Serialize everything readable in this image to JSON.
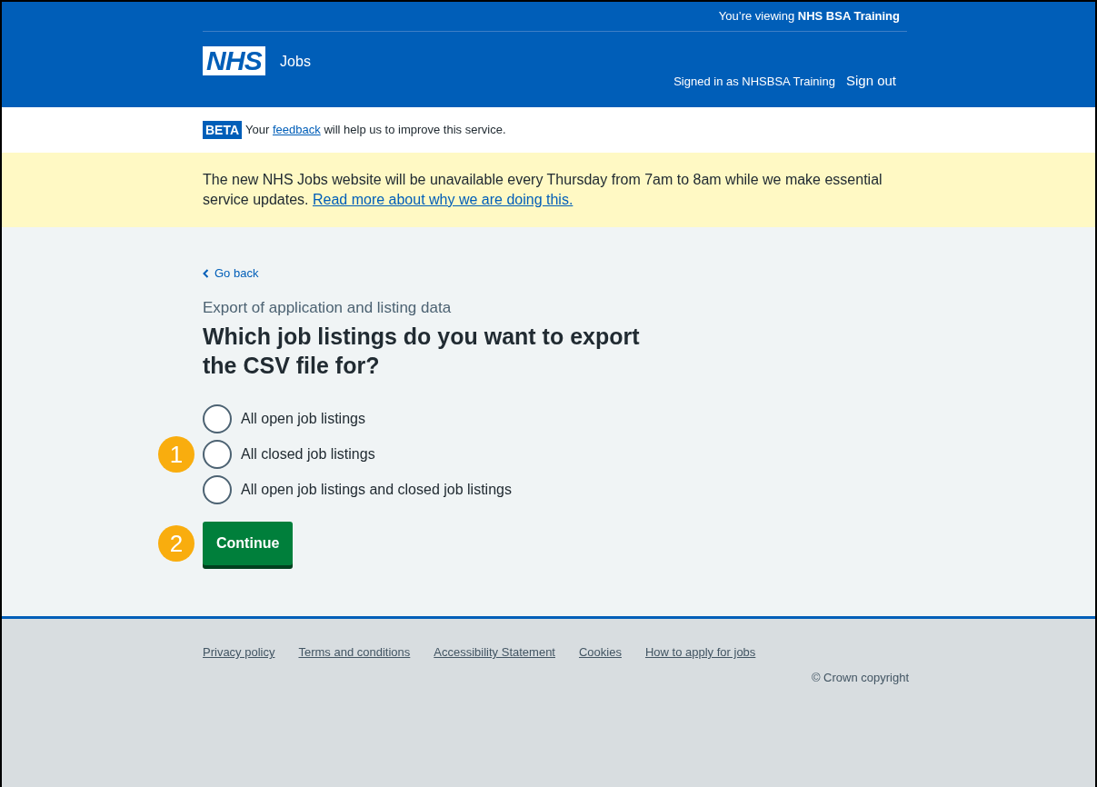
{
  "header": {
    "viewing_prefix": "You’re viewing",
    "viewing_org": "NHS BSA Training",
    "logo": "NHS",
    "service": "Jobs",
    "signed_in": "Signed in as NHSBSA Training",
    "sign_out": "Sign out"
  },
  "phase_banner": {
    "tag": "BETA",
    "before": "Your",
    "link": "feedback",
    "after": "will help us to improve this service."
  },
  "notice": {
    "text": "The new NHS Jobs website will be unavailable every Thursday from 7am to 8am while we make essential service updates.",
    "link": "Read more about why we are doing this."
  },
  "back_link": "Go back",
  "caption": "Export of application and listing data",
  "heading": "Which job listings do you want to export the CSV file for?",
  "options": [
    {
      "label": "All open job listings",
      "selected": false
    },
    {
      "label": "All closed job listings",
      "selected": false,
      "callout": "1"
    },
    {
      "label": "All open job listings and closed job listings",
      "selected": false
    }
  ],
  "button": {
    "label": "Continue",
    "callout": "2"
  },
  "footer": {
    "links": [
      "Privacy policy",
      "Terms and conditions",
      "Accessibility Statement",
      "Cookies",
      "How to apply for jobs"
    ],
    "copyright": "© Crown copyright"
  }
}
